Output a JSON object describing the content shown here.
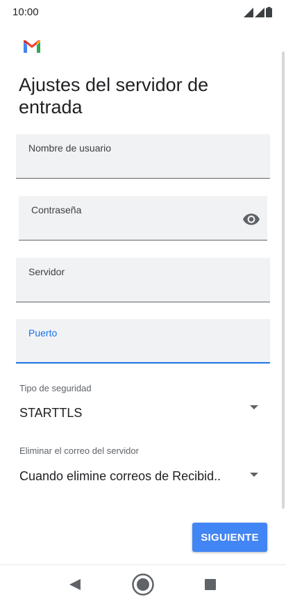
{
  "status_bar": {
    "time": "10:00"
  },
  "header": {
    "title": "Ajustes del servidor de entrada"
  },
  "form": {
    "username": {
      "label": "Nombre de usuario",
      "value": ""
    },
    "password": {
      "label": "Contraseña",
      "value": ""
    },
    "server": {
      "label": "Servidor",
      "value": ""
    },
    "port": {
      "label": "Puerto",
      "value": ""
    },
    "security_type": {
      "label": "Tipo de seguridad",
      "value": "STARTTLS"
    },
    "delete_from_server": {
      "label": "Eliminar el correo del servidor",
      "value": "Cuando elimine correos de Recibid.."
    }
  },
  "actions": {
    "next_label": "SIGUIENTE"
  },
  "colors": {
    "accent": "#1a73e8",
    "button": "#4285f4",
    "field_bg": "#f1f2f4"
  },
  "icons": [
    "signal-icon",
    "battery-icon",
    "gmail-logo",
    "eye-icon",
    "dropdown-arrow-icon",
    "back-icon",
    "home-icon",
    "recents-icon"
  ]
}
